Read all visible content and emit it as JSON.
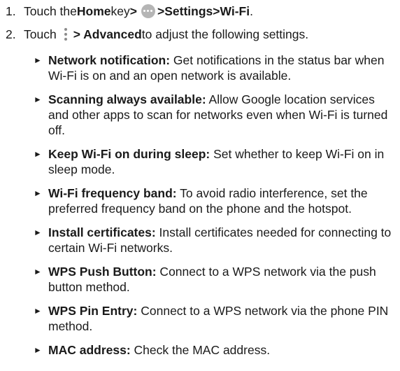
{
  "steps": [
    {
      "number": "1.",
      "parts": [
        "Touch the ",
        "Home",
        " key ",
        ">",
        " > ",
        "Settings",
        " > ",
        "Wi-Fi",
        "."
      ]
    },
    {
      "number": "2.",
      "parts": [
        "Touch ",
        "> Advanced",
        " to adjust the following settings."
      ]
    }
  ],
  "icons": {
    "apps": "apps-icon",
    "menu": "kebab-menu-icon",
    "bullet": "triangle-right-icon"
  },
  "bullet_glyph": "►",
  "settings": [
    {
      "term": "Network notification:",
      "desc": " Get notifications in the status bar when Wi-Fi is on and an open network is available."
    },
    {
      "term": "Scanning always available:",
      "desc": " Allow Google location services and other apps to scan for networks even when Wi-Fi is turned off."
    },
    {
      "term": "Keep Wi-Fi on during sleep:",
      "desc": " Set whether to keep Wi-Fi on in sleep mode."
    },
    {
      "term": "Wi-Fi frequency band:",
      "desc": " To avoid radio interference, set the preferred frequency band on the phone and the hotspot."
    },
    {
      "term": "Install certificates:",
      "desc": " Install certificates needed for connecting to certain Wi-Fi networks."
    },
    {
      "term": "WPS Push Button:",
      "desc": " Connect to a WPS network via the push button method."
    },
    {
      "term": "WPS Pin Entry:",
      "desc": " Connect to a WPS network via the phone PIN method."
    },
    {
      "term": "MAC address:",
      "desc": " Check the MAC address."
    }
  ]
}
